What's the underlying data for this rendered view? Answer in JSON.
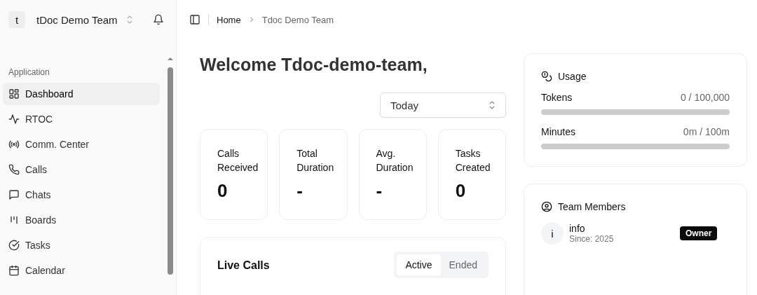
{
  "team": {
    "avatar": "t",
    "name": "tDoc Demo Team"
  },
  "sidebar": {
    "section": "Application",
    "items": [
      {
        "label": "Dashboard",
        "selected": true
      },
      {
        "label": "RTOC",
        "selected": false
      },
      {
        "label": "Comm. Center",
        "selected": false
      },
      {
        "label": "Calls",
        "selected": false
      },
      {
        "label": "Chats",
        "selected": false
      },
      {
        "label": "Boards",
        "selected": false
      },
      {
        "label": "Tasks",
        "selected": false
      },
      {
        "label": "Calendar",
        "selected": false
      }
    ]
  },
  "breadcrumb": [
    "Home",
    "Tdoc Demo Team"
  ],
  "heading": "Welcome Tdoc-demo-team,",
  "period": {
    "value": "Today"
  },
  "stats": [
    {
      "label": "Calls Received",
      "value": "0"
    },
    {
      "label": "Total Duration",
      "value": "-"
    },
    {
      "label": "Avg. Duration",
      "value": "-"
    },
    {
      "label": "Tasks Created",
      "value": "0"
    }
  ],
  "live_calls": {
    "title": "Live Calls",
    "tabs": [
      {
        "label": "Active",
        "selected": true
      },
      {
        "label": "Ended",
        "selected": false
      }
    ]
  },
  "usage": {
    "title": "Usage",
    "meters": [
      {
        "name": "Tokens",
        "reading": "0 / 100,000",
        "level": 0
      },
      {
        "name": "Minutes",
        "reading": "0m / 100m",
        "level": 0
      }
    ]
  },
  "team_members": {
    "title": "Team Members",
    "members": [
      {
        "avatar": "i",
        "name": "info",
        "since": "Since: 2025",
        "role": "Owner"
      }
    ]
  }
}
